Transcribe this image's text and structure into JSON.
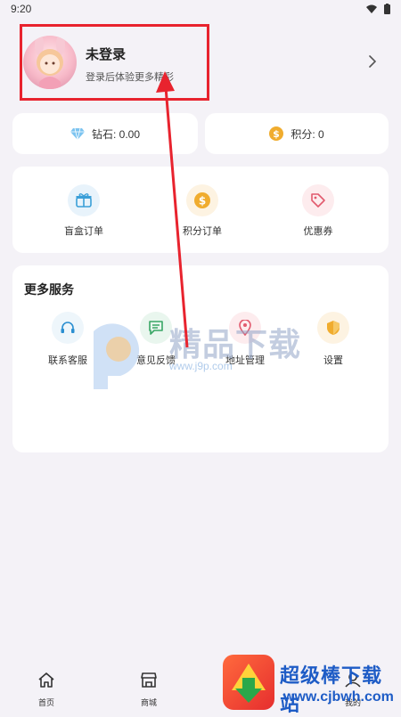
{
  "status_bar": {
    "time": "9:20"
  },
  "profile": {
    "name": "未登录",
    "subtitle": "登录后体验更多精彩"
  },
  "stats": {
    "diamonds_label": "钻石: 0.00",
    "points_label": "积分: 0"
  },
  "orders": [
    {
      "label": "盲盒订单",
      "icon": "gift-box-icon"
    },
    {
      "label": "积分订单",
      "icon": "coin-icon"
    },
    {
      "label": "优惠券",
      "icon": "tag-icon"
    }
  ],
  "services": {
    "title": "更多服务",
    "items": [
      {
        "label": "联系客服",
        "icon": "headset-icon"
      },
      {
        "label": "意见反馈",
        "icon": "chat-icon"
      },
      {
        "label": "地址管理",
        "icon": "location-icon"
      },
      {
        "label": "设置",
        "icon": "shield-icon"
      }
    ]
  },
  "watermark": {
    "main": "精品下载",
    "url": "www.j9p.com"
  },
  "bottom_nav": [
    {
      "label": "首页",
      "icon": "home-icon"
    },
    {
      "label": "商城",
      "icon": "shop-icon"
    },
    {
      "label": "我的",
      "icon": "profile-icon"
    }
  ],
  "logo_watermark": {
    "text": "超级棒下载站",
    "url": "www.cjbwh.com"
  },
  "colors": {
    "accent_red": "#e8232e",
    "background": "#f4f2f7",
    "card": "#ffffff"
  }
}
